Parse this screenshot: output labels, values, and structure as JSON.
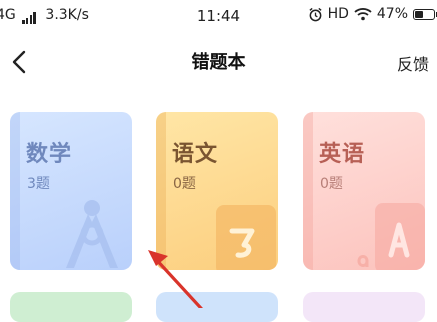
{
  "status_bar": {
    "network": "4G",
    "speed": "3.3K/s",
    "time": "11:44",
    "hd": "HD",
    "battery": "47%",
    "battery_level": 0.47
  },
  "nav": {
    "title": "错题本",
    "feedback": "反馈"
  },
  "books": [
    {
      "subject": "数学",
      "count": "3题",
      "color": "#b9d0fb"
    },
    {
      "subject": "语文",
      "count": "0题",
      "color": "#fcce7e"
    },
    {
      "subject": "英语",
      "count": "0题",
      "color": "#fcc3bd"
    }
  ],
  "annotation": {
    "arrow_color": "#d9342b"
  }
}
